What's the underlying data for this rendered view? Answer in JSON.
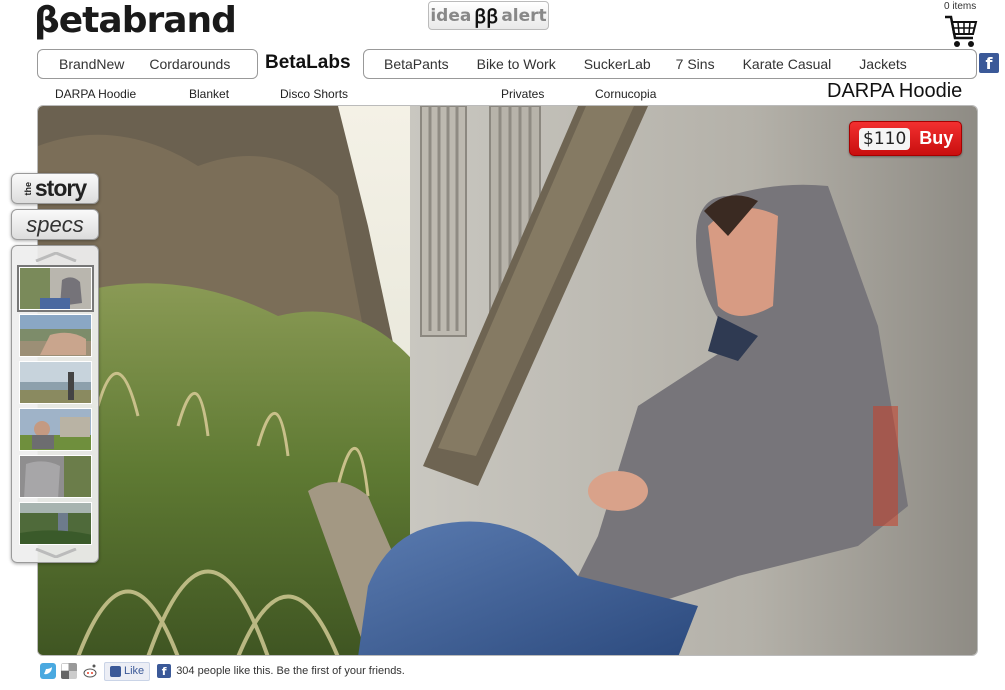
{
  "brand": {
    "logo_text": "βetabrand"
  },
  "idea_alert": {
    "left": "idea",
    "mark": "ꞵꞵ",
    "right": "alert"
  },
  "cart": {
    "count_label": "0 items"
  },
  "facebook": {
    "badge": "f"
  },
  "nav": {
    "left_items": [
      "BrandNew",
      "Cordarounds"
    ],
    "current": "BetaLabs",
    "right_items": [
      "BetaPants",
      "Bike to Work",
      "SuckerLab",
      "7 Sins",
      "Karate Casual",
      "Jackets"
    ]
  },
  "subnav": {
    "items": [
      "DARPA Hoodie",
      "Blanket",
      "Disco Shorts",
      "Privates",
      "Cornucopia"
    ]
  },
  "product": {
    "title": "DARPA Hoodie",
    "price": "$110",
    "buy_label": "Buy"
  },
  "side_tabs": {
    "story_the": "the",
    "story": "story",
    "specs": "specs"
  },
  "social": {
    "like_label": "Like",
    "fb_small": "f",
    "like_text": "304 people like this. Be the first of your friends."
  },
  "colors": {
    "buy_red": "#e01b1b",
    "facebook_blue": "#3b5998"
  }
}
